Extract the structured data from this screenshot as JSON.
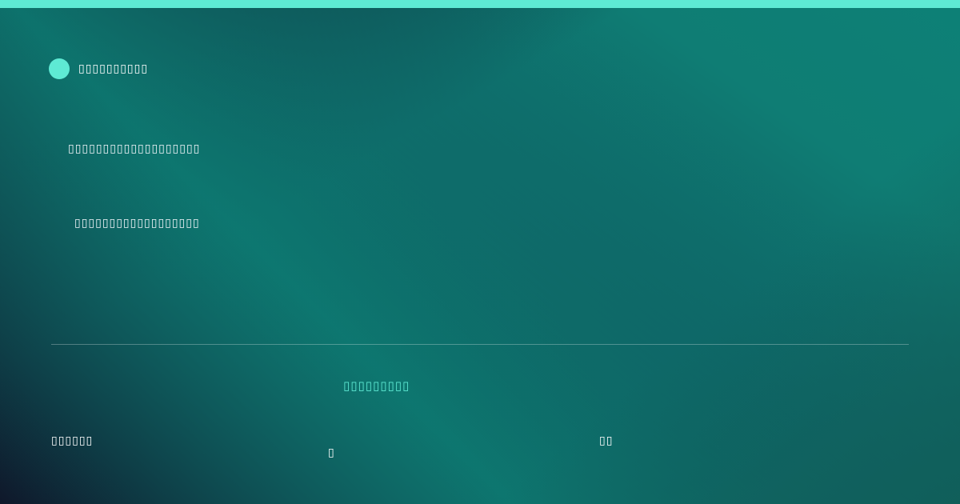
{
  "colors": {
    "accent": "#5eead4",
    "background_dark": "#0f172a",
    "background_teal": "#0d8076",
    "text": "#ffffff"
  },
  "brand": {
    "icon": "circle-logo-icon",
    "name": "▯▯▯▯▯▯▯▯▯▯"
  },
  "content": {
    "line1": "▯▯▯▯▯▯▯▯▯▯▯▯▯▯▯▯▯▯▯",
    "line2": "▯▯▯▯▯▯▯▯▯▯▯▯▯▯▯▯▯▯"
  },
  "footer": {
    "accent_text": "▯▯▯▯▯▯▯▯▯",
    "left": "▯▯▯▯▯▯",
    "middle": "▯",
    "right": "▯▯"
  }
}
